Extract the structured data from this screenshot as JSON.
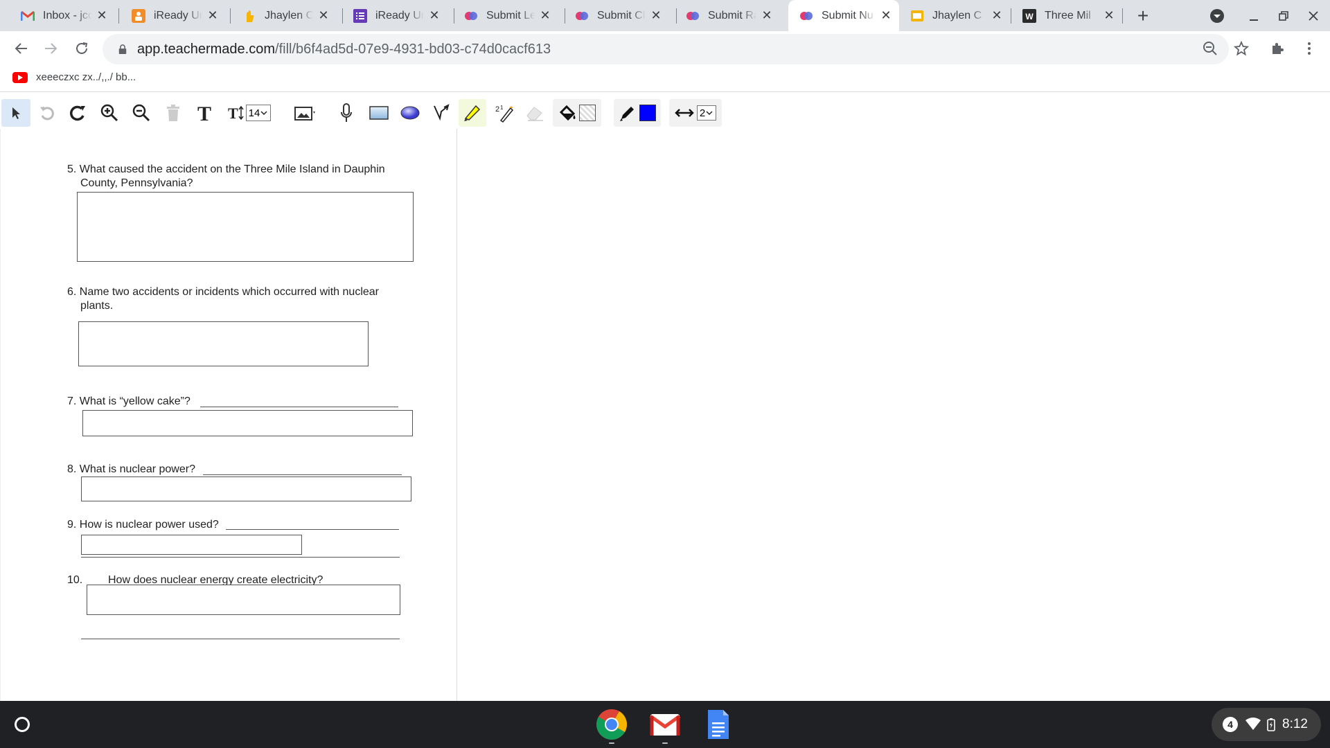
{
  "tabs": [
    {
      "title": "Inbox - jco",
      "icon": "gmail-icon",
      "active": false
    },
    {
      "title": "iReady Un",
      "icon": "iready-icon",
      "active": false
    },
    {
      "title": "Jhaylen C",
      "icon": "hand-icon",
      "active": false
    },
    {
      "title": "iReady Un",
      "icon": "forms-icon",
      "active": false
    },
    {
      "title": "Submit Le",
      "icon": "teachermade-icon",
      "active": false
    },
    {
      "title": "Submit Ch",
      "icon": "teachermade-icon",
      "active": false
    },
    {
      "title": "Submit Ra",
      "icon": "teachermade-icon",
      "active": false
    },
    {
      "title": "Submit Nu",
      "icon": "teachermade-icon",
      "active": true
    },
    {
      "title": "Jhaylen C",
      "icon": "slides-icon",
      "active": false
    },
    {
      "title": "Three Mil",
      "icon": "word-icon",
      "active": false
    }
  ],
  "address_bar": {
    "domain": "app.teachermade.com",
    "path": "/fill/b6f4ad5d-07e9-4931-bd03-c74d0cacf613"
  },
  "bookmarks": [
    {
      "label": "xeeeczxc zx../,,./ bb..."
    }
  ],
  "editor_toolbar": {
    "font_size": "14",
    "line_width": "2",
    "colors": {
      "fill": "#f0f0f0",
      "stroke": "#0000ff",
      "highlighter": "#ffff00"
    }
  },
  "questions": [
    {
      "number": "5.",
      "line1": "What caused the accident on the Three Mile Island in Dauphin",
      "line2": "County, Pennsylvania?"
    },
    {
      "number": "6.",
      "line1": "Name two accidents or incidents which occurred with nuclear",
      "line2": "plants."
    },
    {
      "number": "7.",
      "line1": "What is “yellow cake”?"
    },
    {
      "number": "8.",
      "line1": "What is nuclear power?"
    },
    {
      "number": "9.",
      "line1": "How is nuclear power used?"
    },
    {
      "number": "10.",
      "line1": "How does nuclear energy create electricity?"
    }
  ],
  "shelf": {
    "apps": [
      "chrome-icon",
      "gmail-icon",
      "docs-icon"
    ],
    "notification_count": "4",
    "time": "8:12"
  }
}
